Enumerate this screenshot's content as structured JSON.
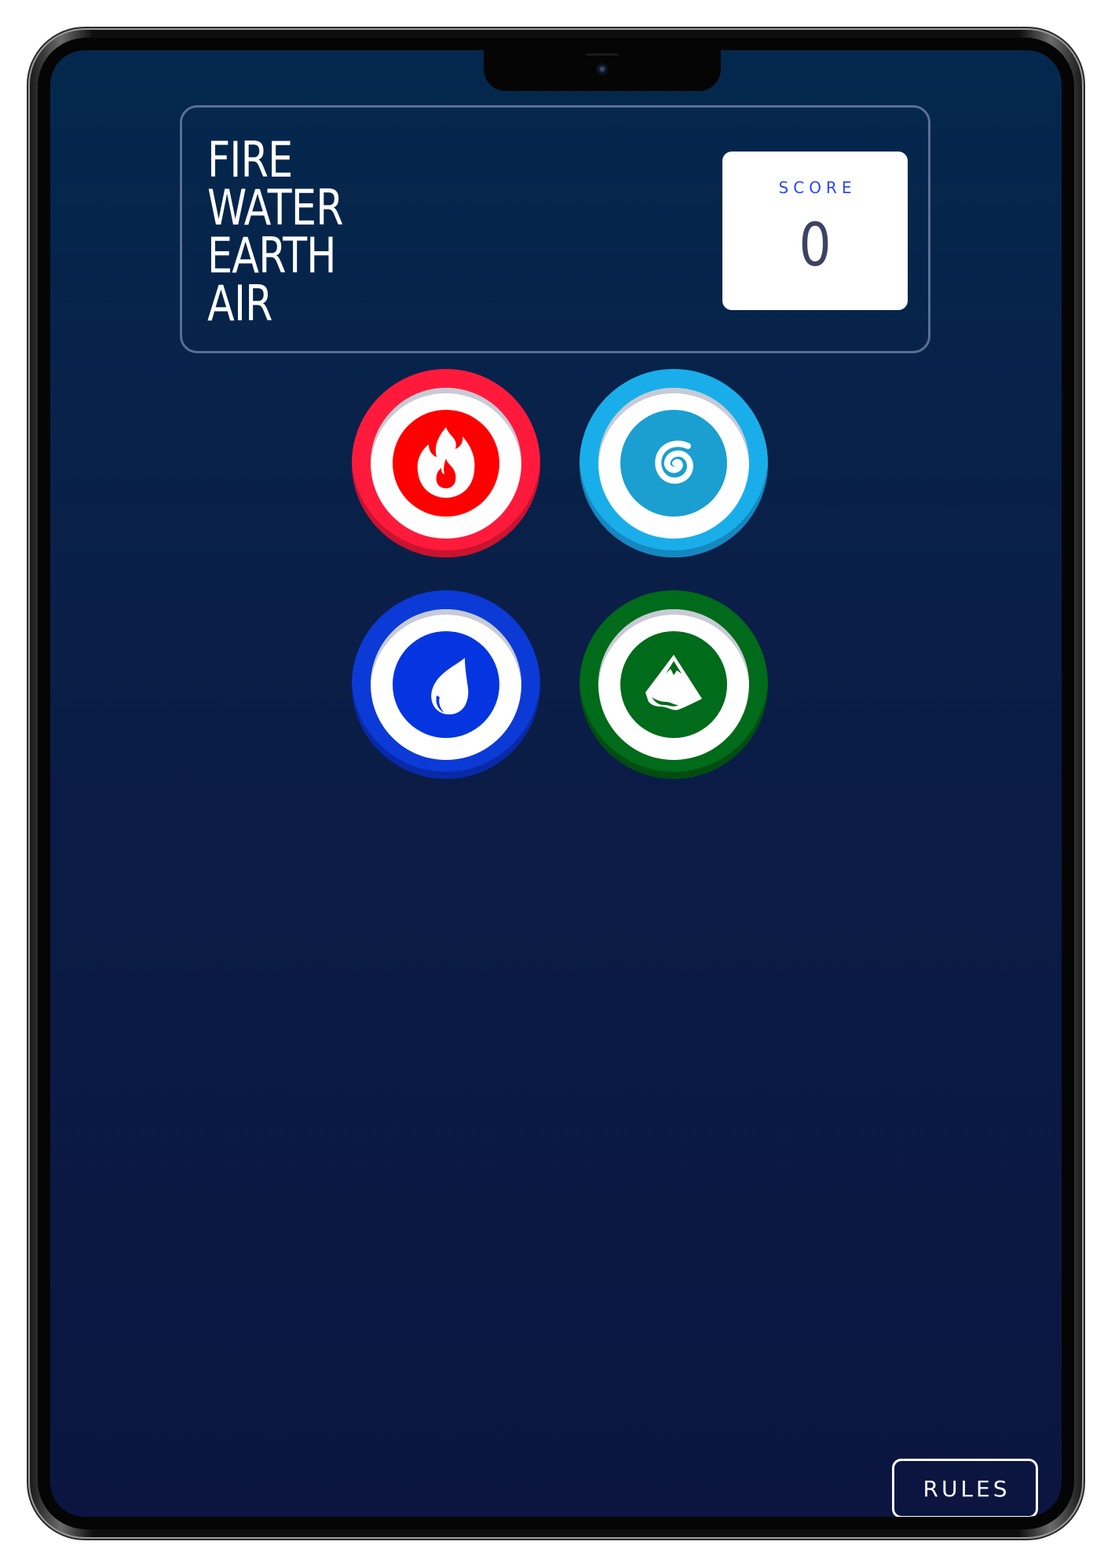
{
  "title_lines": [
    "FIRE",
    "WATER",
    "EARTH",
    "AIR"
  ],
  "score": {
    "label": "SCORE",
    "value": "0"
  },
  "tokens": [
    {
      "element": "fire",
      "icon": "flame-icon",
      "outer_color": "#ff1a3c",
      "shadow_color": "#c9132f",
      "inner_color": "#ff0000"
    },
    {
      "element": "air",
      "icon": "spiral-icon",
      "outer_color": "#19aeea",
      "shadow_color": "#1488bf",
      "inner_color": "#1a9fd0"
    },
    {
      "element": "water",
      "icon": "droplet-icon",
      "outer_color": "#0b3ad6",
      "shadow_color": "#082aa8",
      "inner_color": "#0535e0"
    },
    {
      "element": "earth",
      "icon": "mountain-icon",
      "outer_color": "#006b1a",
      "shadow_color": "#004d12",
      "inner_color": "#006b1a"
    }
  ],
  "rules_button": {
    "label": "RULES"
  }
}
